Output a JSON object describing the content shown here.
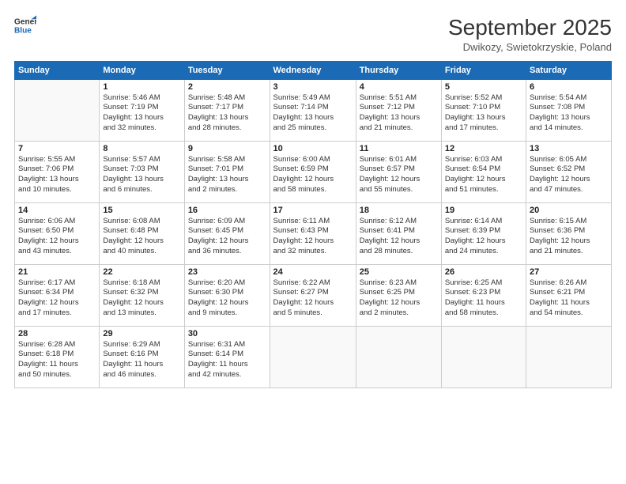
{
  "logo": {
    "line1": "General",
    "line2": "Blue"
  },
  "title": "September 2025",
  "subtitle": "Dwikozy, Swietokrzyskie, Poland",
  "days_header": [
    "Sunday",
    "Monday",
    "Tuesday",
    "Wednesday",
    "Thursday",
    "Friday",
    "Saturday"
  ],
  "weeks": [
    [
      {
        "day": "",
        "info": ""
      },
      {
        "day": "1",
        "info": "Sunrise: 5:46 AM\nSunset: 7:19 PM\nDaylight: 13 hours\nand 32 minutes."
      },
      {
        "day": "2",
        "info": "Sunrise: 5:48 AM\nSunset: 7:17 PM\nDaylight: 13 hours\nand 28 minutes."
      },
      {
        "day": "3",
        "info": "Sunrise: 5:49 AM\nSunset: 7:14 PM\nDaylight: 13 hours\nand 25 minutes."
      },
      {
        "day": "4",
        "info": "Sunrise: 5:51 AM\nSunset: 7:12 PM\nDaylight: 13 hours\nand 21 minutes."
      },
      {
        "day": "5",
        "info": "Sunrise: 5:52 AM\nSunset: 7:10 PM\nDaylight: 13 hours\nand 17 minutes."
      },
      {
        "day": "6",
        "info": "Sunrise: 5:54 AM\nSunset: 7:08 PM\nDaylight: 13 hours\nand 14 minutes."
      }
    ],
    [
      {
        "day": "7",
        "info": "Sunrise: 5:55 AM\nSunset: 7:06 PM\nDaylight: 13 hours\nand 10 minutes."
      },
      {
        "day": "8",
        "info": "Sunrise: 5:57 AM\nSunset: 7:03 PM\nDaylight: 13 hours\nand 6 minutes."
      },
      {
        "day": "9",
        "info": "Sunrise: 5:58 AM\nSunset: 7:01 PM\nDaylight: 13 hours\nand 2 minutes."
      },
      {
        "day": "10",
        "info": "Sunrise: 6:00 AM\nSunset: 6:59 PM\nDaylight: 12 hours\nand 58 minutes."
      },
      {
        "day": "11",
        "info": "Sunrise: 6:01 AM\nSunset: 6:57 PM\nDaylight: 12 hours\nand 55 minutes."
      },
      {
        "day": "12",
        "info": "Sunrise: 6:03 AM\nSunset: 6:54 PM\nDaylight: 12 hours\nand 51 minutes."
      },
      {
        "day": "13",
        "info": "Sunrise: 6:05 AM\nSunset: 6:52 PM\nDaylight: 12 hours\nand 47 minutes."
      }
    ],
    [
      {
        "day": "14",
        "info": "Sunrise: 6:06 AM\nSunset: 6:50 PM\nDaylight: 12 hours\nand 43 minutes."
      },
      {
        "day": "15",
        "info": "Sunrise: 6:08 AM\nSunset: 6:48 PM\nDaylight: 12 hours\nand 40 minutes."
      },
      {
        "day": "16",
        "info": "Sunrise: 6:09 AM\nSunset: 6:45 PM\nDaylight: 12 hours\nand 36 minutes."
      },
      {
        "day": "17",
        "info": "Sunrise: 6:11 AM\nSunset: 6:43 PM\nDaylight: 12 hours\nand 32 minutes."
      },
      {
        "day": "18",
        "info": "Sunrise: 6:12 AM\nSunset: 6:41 PM\nDaylight: 12 hours\nand 28 minutes."
      },
      {
        "day": "19",
        "info": "Sunrise: 6:14 AM\nSunset: 6:39 PM\nDaylight: 12 hours\nand 24 minutes."
      },
      {
        "day": "20",
        "info": "Sunrise: 6:15 AM\nSunset: 6:36 PM\nDaylight: 12 hours\nand 21 minutes."
      }
    ],
    [
      {
        "day": "21",
        "info": "Sunrise: 6:17 AM\nSunset: 6:34 PM\nDaylight: 12 hours\nand 17 minutes."
      },
      {
        "day": "22",
        "info": "Sunrise: 6:18 AM\nSunset: 6:32 PM\nDaylight: 12 hours\nand 13 minutes."
      },
      {
        "day": "23",
        "info": "Sunrise: 6:20 AM\nSunset: 6:30 PM\nDaylight: 12 hours\nand 9 minutes."
      },
      {
        "day": "24",
        "info": "Sunrise: 6:22 AM\nSunset: 6:27 PM\nDaylight: 12 hours\nand 5 minutes."
      },
      {
        "day": "25",
        "info": "Sunrise: 6:23 AM\nSunset: 6:25 PM\nDaylight: 12 hours\nand 2 minutes."
      },
      {
        "day": "26",
        "info": "Sunrise: 6:25 AM\nSunset: 6:23 PM\nDaylight: 11 hours\nand 58 minutes."
      },
      {
        "day": "27",
        "info": "Sunrise: 6:26 AM\nSunset: 6:21 PM\nDaylight: 11 hours\nand 54 minutes."
      }
    ],
    [
      {
        "day": "28",
        "info": "Sunrise: 6:28 AM\nSunset: 6:18 PM\nDaylight: 11 hours\nand 50 minutes."
      },
      {
        "day": "29",
        "info": "Sunrise: 6:29 AM\nSunset: 6:16 PM\nDaylight: 11 hours\nand 46 minutes."
      },
      {
        "day": "30",
        "info": "Sunrise: 6:31 AM\nSunset: 6:14 PM\nDaylight: 11 hours\nand 42 minutes."
      },
      {
        "day": "",
        "info": ""
      },
      {
        "day": "",
        "info": ""
      },
      {
        "day": "",
        "info": ""
      },
      {
        "day": "",
        "info": ""
      }
    ]
  ]
}
